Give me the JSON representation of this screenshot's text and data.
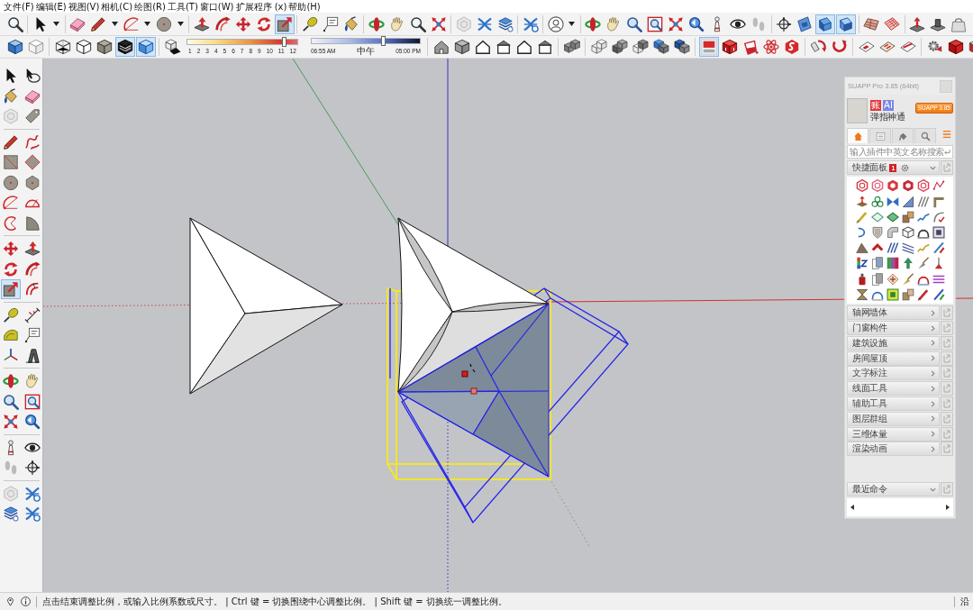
{
  "menu_bar": {
    "items": [
      "文件(F)",
      "编辑(E)",
      "视图(V)",
      "相机(C)",
      "绘图(R)",
      "工具(T)",
      "窗口(W)",
      "扩展程序 (x)",
      "帮助(H)"
    ]
  },
  "toolbar_row_1": {
    "tools": [
      {
        "selected": false
      },
      {
        "selected": false
      },
      {
        "selected": false
      },
      {
        "selected": false
      },
      {
        "selected": false
      },
      {
        "selected": false
      },
      {
        "selected": false
      },
      {
        "selected": false
      },
      {
        "selected": false
      },
      {
        "selected": false
      },
      {
        "selected": true
      },
      {
        "selected": false
      },
      {
        "selected": false
      },
      {
        "selected": false
      },
      {
        "selected": false
      },
      {
        "selected": false
      },
      {
        "selected": false
      },
      {
        "selected": false
      },
      {
        "selected": false
      },
      {
        "selected": false
      },
      {
        "selected": false
      },
      {
        "selected": false
      },
      {
        "selected": false
      },
      {
        "selected": false
      },
      {
        "selected": false
      },
      {
        "selected": false
      },
      {
        "selected": false
      },
      {
        "selected": false
      },
      {
        "selected": false
      },
      {
        "selected": false
      },
      {
        "selected": false
      },
      {
        "selected": false
      },
      {
        "selected": false
      },
      {
        "selected": false
      },
      {
        "selected": true
      },
      {
        "selected": true
      },
      {
        "selected": false
      },
      {
        "selected": false
      },
      {
        "selected": false
      },
      {
        "selected": false
      },
      {
        "selected": false
      }
    ]
  },
  "toolbar_row_2": {
    "style_tools": [
      {
        "selected": false
      },
      {
        "selected": false
      },
      {
        "selected": false
      },
      {
        "selected": false
      },
      {
        "selected": false
      },
      {
        "selected": true
      },
      {
        "selected": true
      },
      {
        "selected": false
      }
    ],
    "month_slider": {
      "level": 0.88,
      "ticks": [
        "1",
        "2",
        "3",
        "4",
        "5",
        "6",
        "7",
        "8",
        "9",
        "10",
        "11",
        "12"
      ]
    },
    "time_slider": {
      "level": 0.66,
      "labels": [
        "06:55 AM",
        "中午",
        "05:00 PM"
      ]
    },
    "tools": [
      {
        "selected": false
      },
      {
        "selected": false
      },
      {
        "selected": false
      },
      {
        "selected": false
      },
      {
        "selected": false
      },
      {
        "selected": false
      },
      {
        "selected": false
      },
      {
        "selected": false
      },
      {
        "selected": false
      },
      {
        "selected": false
      },
      {
        "selected": false
      },
      {
        "selected": false
      },
      {
        "selected": true
      },
      {
        "selected": false
      },
      {
        "selected": false
      },
      {
        "selected": false
      },
      {
        "selected": false
      },
      {
        "selected": false
      },
      {
        "selected": false
      },
      {
        "selected": false
      },
      {
        "selected": false
      },
      {
        "selected": false
      },
      {
        "selected": false
      },
      {
        "selected": false
      },
      {
        "selected": false
      }
    ]
  },
  "left_toolbar": {
    "tools": [
      {
        "selected": false
      },
      {
        "selected": false
      },
      {
        "selected": false
      },
      {
        "selected": false
      },
      {
        "selected": false
      },
      {
        "selected": false
      },
      {
        "selected": false
      },
      {
        "selected": false
      },
      {
        "selected": false
      },
      {
        "selected": false
      },
      {
        "selected": false
      },
      {
        "selected": false
      },
      {
        "selected": false
      },
      {
        "selected": false
      },
      {
        "selected": false
      },
      {
        "selected": false
      },
      {
        "selected": false
      },
      {
        "selected": false
      },
      {
        "selected": false
      },
      {
        "selected": false
      },
      {
        "selected": true
      },
      {
        "selected": false
      },
      {
        "selected": false
      },
      {
        "selected": false
      },
      {
        "selected": false
      },
      {
        "selected": false
      },
      {
        "selected": false
      },
      {
        "selected": false
      },
      {
        "selected": false
      },
      {
        "selected": false
      },
      {
        "selected": false
      },
      {
        "selected": false
      },
      {
        "selected": false
      },
      {
        "selected": false
      },
      {
        "selected": false
      },
      {
        "selected": false
      },
      {
        "selected": false
      },
      {
        "selected": false
      },
      {
        "selected": false
      },
      {
        "selected": false
      },
      {
        "selected": false
      },
      {
        "selected": false
      }
    ]
  },
  "suapp_panel": {
    "title": "SUAPP Pro 3.85 (64bit)",
    "user": {
      "badges": [
        {
          "text": "账",
          "color": "#e0383b"
        },
        {
          "text": "AI",
          "color": "#7a86e6"
        }
      ],
      "name": "弹指神通",
      "version_button": "SUAPP 3.85"
    },
    "tabs": [
      {
        "selected": true
      },
      {
        "selected": false
      },
      {
        "selected": false
      },
      {
        "selected": false
      }
    ],
    "search": {
      "placeholder": "输入插件中英文名称搜索"
    },
    "quick_panel": {
      "title": "快捷面板",
      "badge": "1",
      "expanded": true
    },
    "categories": [
      {
        "title": "轴网墙体",
        "expanded": false
      },
      {
        "title": "门窗构件",
        "expanded": false
      },
      {
        "title": "建筑设施",
        "expanded": false
      },
      {
        "title": "房间屋顶",
        "expanded": false
      },
      {
        "title": "文字标注",
        "expanded": false
      },
      {
        "title": "线面工具",
        "expanded": false
      },
      {
        "title": "辅助工具",
        "expanded": false
      },
      {
        "title": "图层群组",
        "expanded": false
      },
      {
        "title": "三维体量",
        "expanded": false
      },
      {
        "title": "渲染动画",
        "expanded": false
      }
    ],
    "recent": {
      "title": "最近命令",
      "expanded": true
    }
  },
  "status_bar": {
    "message": "点击结束调整比例，或输入比例系数或尺寸。 | Ctrl 键 = 切换围绕中心调整比例。 | Shift 键 = 切换统一调整比例。",
    "measurement_label": "沿"
  }
}
